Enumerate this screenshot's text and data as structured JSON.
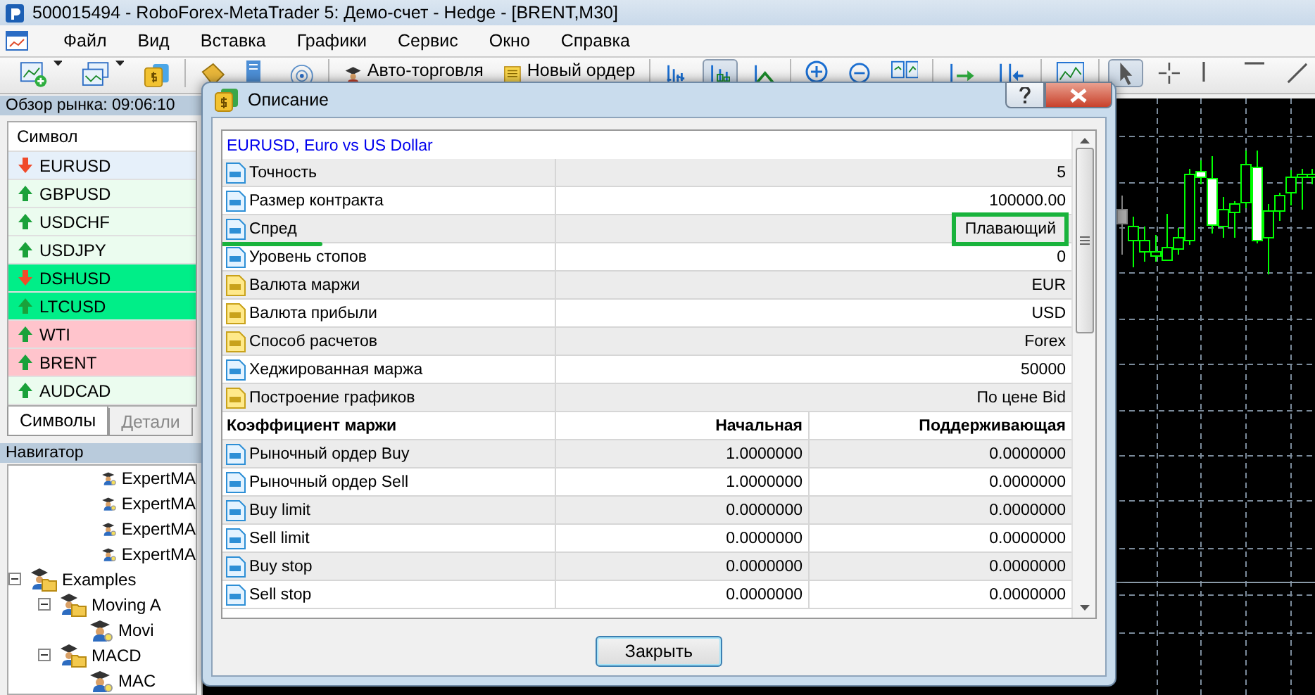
{
  "window": {
    "title": "500015494 - RoboForex-MetaTrader 5: Демо-счет - Hedge - [BRENT,M30]"
  },
  "menu": [
    "Файл",
    "Вид",
    "Вставка",
    "Графики",
    "Сервис",
    "Окно",
    "Справка"
  ],
  "toolbar": {
    "buttons": [
      {
        "label": "Авто-торговля"
      },
      {
        "label": "Новый ордер"
      }
    ],
    "chart_type_buttons": [
      {
        "selected": false
      },
      {
        "selected": true
      },
      {
        "selected": false
      }
    ],
    "drawing_tools": [
      {
        "kind": "cursor",
        "selected": true
      },
      {
        "kind": "crosshair",
        "selected": false
      },
      {
        "kind": "vertical-line",
        "selected": false
      },
      {
        "kind": "horizontal-line",
        "selected": false
      },
      {
        "kind": "trend-line",
        "selected": false
      }
    ]
  },
  "market_watch": {
    "title": "Обзор рынка: 09:06:10",
    "column": "Символ",
    "rows": [
      {
        "symbol": "EURUSD",
        "kind": "down",
        "color": "#e6f0fa"
      },
      {
        "symbol": "GBPUSD",
        "kind": "up",
        "color": "#ebfcef"
      },
      {
        "symbol": "USDCHF",
        "kind": "up",
        "color": "#ebfcef"
      },
      {
        "symbol": "USDJPY",
        "kind": "up",
        "color": "#ebfcef"
      },
      {
        "symbol": "DSHUSD",
        "kind": "down",
        "color": "#00ee88"
      },
      {
        "symbol": "LTCUSD",
        "kind": "up",
        "color": "#00ee88"
      },
      {
        "symbol": "WTI",
        "kind": "up",
        "color": "#ffc4cc"
      },
      {
        "symbol": "BRENT",
        "kind": "up",
        "color": "#ffc4cc"
      },
      {
        "symbol": "AUDCAD",
        "kind": "up",
        "color": "#ebfcef"
      }
    ],
    "tabs": [
      {
        "label": "Символы",
        "selected": true
      },
      {
        "label": "Детали",
        "selected": false
      }
    ]
  },
  "navigator": {
    "title": "Навигатор",
    "tree": [
      {
        "children": [
          {
            "label": "ExpertMA",
            "kind": "expert"
          },
          {
            "label": "ExpertMA",
            "kind": "expert"
          },
          {
            "label": "ExpertMA",
            "kind": "expert"
          },
          {
            "label": "ExpertMA",
            "kind": "expert"
          }
        ]
      },
      {
        "label": "Examples",
        "kind": "folder",
        "expanded": true,
        "children": [
          {
            "label": "Moving A",
            "kind": "folder",
            "expanded": true,
            "children": [
              {
                "label": "Movi",
                "kind": "expert"
              }
            ]
          },
          {
            "label": "MACD",
            "kind": "folder",
            "expanded": true,
            "children": [
              {
                "label": "MAC",
                "kind": "expert"
              }
            ]
          }
        ]
      }
    ]
  },
  "dialog": {
    "title": "Описание",
    "symbol_link": "EURUSD, Euro vs US Dollar",
    "properties": [
      {
        "kind": "number",
        "label": "Точность",
        "value": "5",
        "highlighted": false
      },
      {
        "kind": "number",
        "label": "Размер контракта",
        "value": "100000.00",
        "highlighted": false
      },
      {
        "kind": "number",
        "label": "Спред",
        "value": "Плавающий",
        "highlighted": true
      },
      {
        "kind": "number",
        "label": "Уровень стопов",
        "value": "0",
        "highlighted": false
      },
      {
        "kind": "text",
        "label": "Валюта маржи",
        "value": "EUR",
        "highlighted": false
      },
      {
        "kind": "text",
        "label": "Валюта прибыли",
        "value": "USD",
        "highlighted": false
      },
      {
        "kind": "text",
        "label": "Способ расчетов",
        "value": "Forex",
        "highlighted": false
      },
      {
        "kind": "number",
        "label": "Хеджированная маржа",
        "value": "50000",
        "highlighted": false
      },
      {
        "kind": "text",
        "label": "Построение графиков",
        "value": "По цене Bid",
        "highlighted": false
      }
    ],
    "margin_table": {
      "columns": [
        "Коэффициент маржи",
        "Начальная",
        "Поддерживающая"
      ],
      "rows": [
        {
          "label": "Рыночный ордер Buy",
          "initial": "1.0000000",
          "maintenance": "0.0000000"
        },
        {
          "label": "Рыночный ордер Sell",
          "initial": "1.0000000",
          "maintenance": "0.0000000"
        },
        {
          "label": "Buy limit",
          "initial": "0.0000000",
          "maintenance": "0.0000000"
        },
        {
          "label": "Sell limit",
          "initial": "0.0000000",
          "maintenance": "0.0000000"
        },
        {
          "label": "Buy stop",
          "initial": "0.0000000",
          "maintenance": "0.0000000"
        },
        {
          "label": "Sell stop",
          "initial": "0.0000000",
          "maintenance": "0.0000000"
        }
      ]
    },
    "close_button": "Закрыть"
  }
}
